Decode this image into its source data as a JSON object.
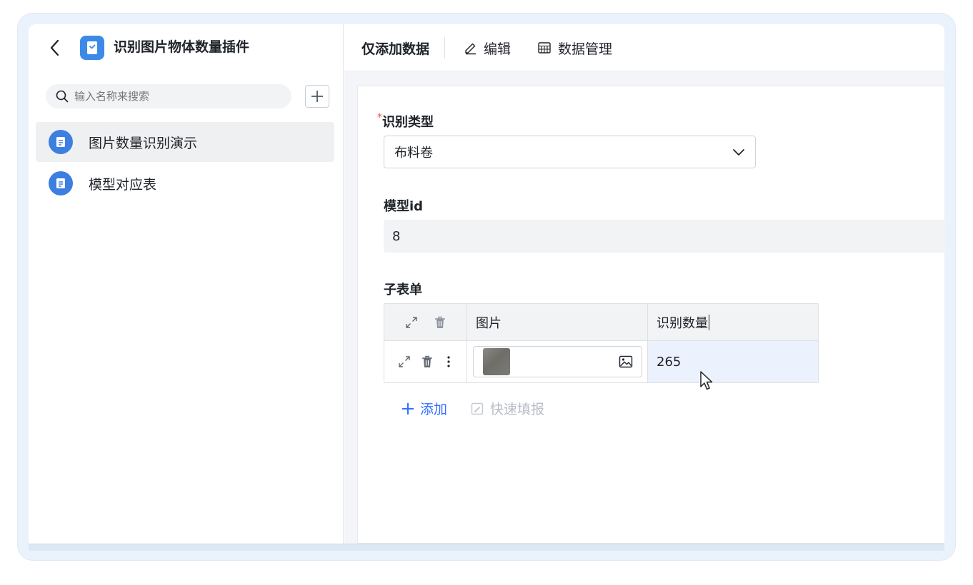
{
  "sidebar": {
    "title": "识别图片物体数量插件",
    "search_placeholder": "输入名称来搜索",
    "items": [
      {
        "label": "图片数量识别演示",
        "active": true
      },
      {
        "label": "模型对应表",
        "active": false
      }
    ]
  },
  "topbar": {
    "mode": "仅添加数据",
    "edit": "编辑",
    "data_manage": "数据管理"
  },
  "form": {
    "type_field": {
      "required_mark": "*",
      "label": "识别类型",
      "value": "布料卷"
    },
    "model_id_field": {
      "label": "模型id",
      "value": "8"
    },
    "subform": {
      "label": "子表单",
      "columns": {
        "image": "图片",
        "count": "识别数量"
      },
      "rows": [
        {
          "count": "265"
        }
      ],
      "add_label": "添加",
      "quick_fill_label": "快速填报"
    }
  },
  "colors": {
    "accent": "#3370ff",
    "app_icon": "#3d8ae6",
    "frame": "#eaf2fc"
  }
}
